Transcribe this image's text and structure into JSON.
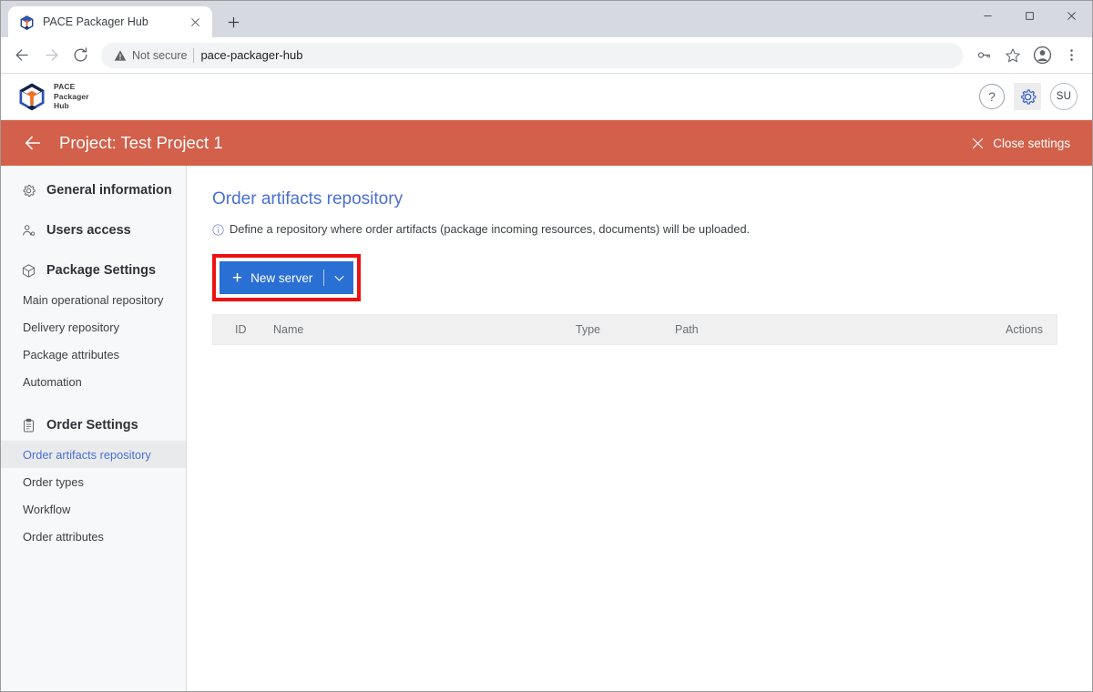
{
  "browser": {
    "tab": {
      "title": "PACE Packager Hub",
      "favicon": "pace-cube-icon",
      "close": "×"
    },
    "new_tab_label": "+",
    "window_controls": {
      "minimize": "—",
      "maximize": "□",
      "close": "✕"
    },
    "nav": {
      "back": "←",
      "forward": "→",
      "reload": "⟳"
    },
    "omnibox": {
      "security_label": "Not secure",
      "url": "pace-packager-hub"
    },
    "toolbar_icons": [
      "key-icon",
      "bookmark-star-icon",
      "profile-avatar-icon",
      "three-dot-menu-icon"
    ]
  },
  "app": {
    "brand": {
      "line1": "PACE",
      "line2": "Packager",
      "line3": "Hub"
    },
    "header_actions": {
      "help": "?",
      "settings_icon": "gear-icon",
      "avatar_initials": "SU"
    },
    "project_bar": {
      "back": "←",
      "title": "Project: Test Project 1",
      "close_settings_label": "Close settings",
      "close_icon": "✕",
      "background_color": "#d2604a"
    }
  },
  "sidebar": {
    "groups": [
      {
        "label": "General information",
        "icon": "gear-icon",
        "items": []
      },
      {
        "label": "Users access",
        "icon": "users-icon",
        "items": []
      },
      {
        "label": "Package Settings",
        "icon": "package-cube-icon",
        "items": [
          {
            "label": "Main operational repository",
            "active": false
          },
          {
            "label": "Delivery repository",
            "active": false
          },
          {
            "label": "Package attributes",
            "active": false
          },
          {
            "label": "Automation",
            "active": false
          }
        ]
      },
      {
        "label": "Order Settings",
        "icon": "clipboard-icon",
        "items": [
          {
            "label": "Order artifacts repository",
            "active": true
          },
          {
            "label": "Order types",
            "active": false
          },
          {
            "label": "Workflow",
            "active": false
          },
          {
            "label": "Order attributes",
            "active": false
          }
        ]
      }
    ],
    "active_color": "#4a6fd4"
  },
  "main": {
    "title": "Order artifacts repository",
    "description": "Define a repository where order artifacts (package incoming resources, documents) will be uploaded.",
    "new_server_button": {
      "label": "New server",
      "plus": "+",
      "caret": "⌄",
      "color": "#2a6fd4",
      "highlight_color": "#ee1111"
    },
    "table": {
      "columns": [
        "ID",
        "Name",
        "Type",
        "Path",
        "Actions"
      ],
      "rows": []
    }
  }
}
